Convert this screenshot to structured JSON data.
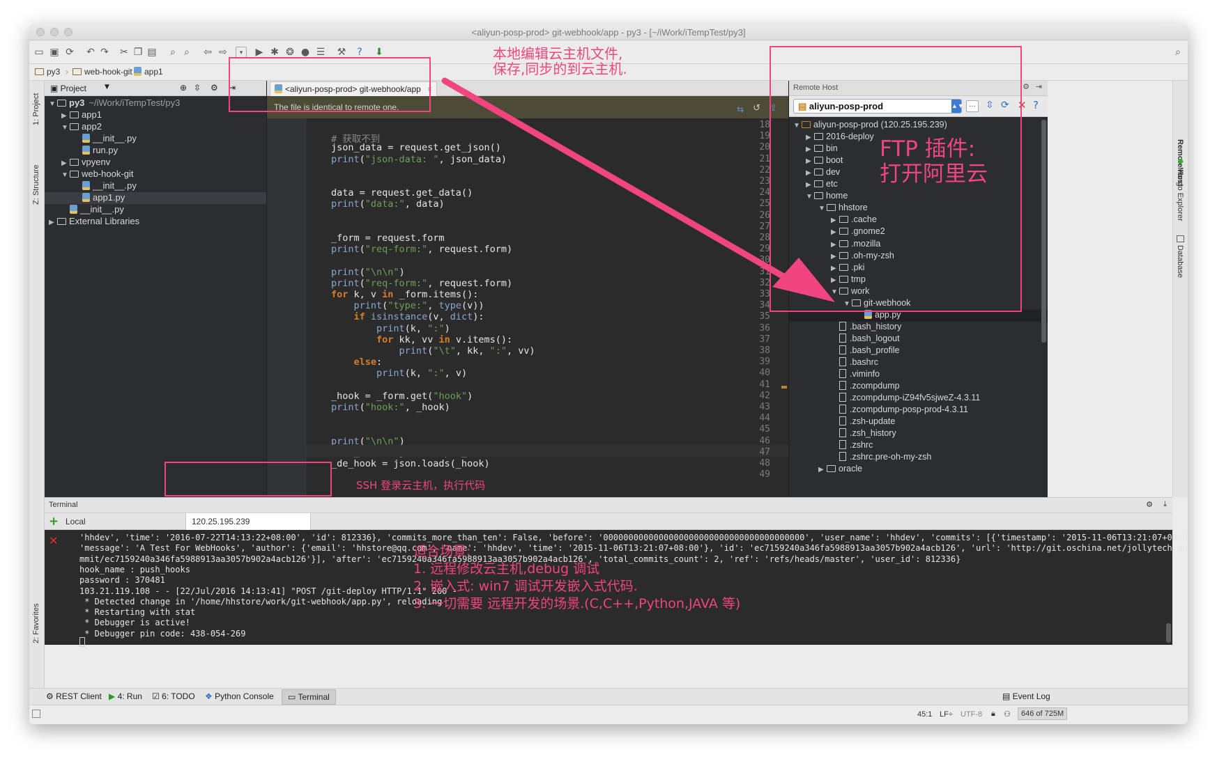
{
  "window": {
    "title": "<aliyun-posp-prod> git-webhook/app - py3 - [~/iWork/iTempTest/py3]"
  },
  "navbar": {
    "crumbs": [
      "py3",
      "web-hook-git",
      "app1"
    ]
  },
  "left_stripe": {
    "project_label": "1: Project",
    "structure_label": "Z: Structure",
    "favorites_label": "2: Favorites"
  },
  "project_panel": {
    "header": "Project",
    "tree": [
      {
        "label": "py3",
        "suffix": "~/iWork/iTempTest/py3",
        "type": "folder",
        "open": true
      },
      {
        "label": "app1",
        "type": "folder",
        "open": false
      },
      {
        "label": "app2",
        "type": "folder",
        "open": true
      },
      {
        "label": "__init__.py",
        "type": "py"
      },
      {
        "label": "run.py",
        "type": "py"
      },
      {
        "label": "vpyenv",
        "type": "folder",
        "open": false
      },
      {
        "label": "web-hook-git",
        "type": "folder",
        "open": true
      },
      {
        "label": "__init__.py",
        "type": "py"
      },
      {
        "label": "app1.py",
        "type": "py",
        "selected": true
      },
      {
        "label": "__init__.py",
        "type": "py"
      },
      {
        "label": "External Libraries",
        "type": "lib",
        "open": false
      }
    ]
  },
  "editor": {
    "tab_label": "<aliyun-posp-prod> git-webhook/app",
    "notice": "The file is identical to remote one.",
    "line_numbers": [
      "18",
      "19",
      "20",
      "21",
      "22",
      "23",
      "24",
      "25",
      "26",
      "27",
      "28",
      "29",
      "30",
      "31",
      "32",
      "33",
      "34",
      "35",
      "36",
      "37",
      "38",
      "39",
      "40",
      "41",
      "42",
      "43",
      "44",
      "45",
      "46",
      "47",
      "48",
      "49"
    ],
    "lines": [
      "",
      "# 获取不到",
      "json_data = request.get_json()",
      "print(\"json-data: \", json_data)",
      "",
      "",
      "data = request.get_data()",
      "print(\"data:\", data)",
      "",
      "",
      "_form = request.form",
      "print(\"req-form:\", request.form)",
      "",
      "print(\"\\n\\n\")",
      "print(\"req-form:\", request.form)",
      "for k, v in _form.items():",
      "    print(\"type:\", type(v))",
      "    if isinstance(v, dict):",
      "        print(k, \":\")",
      "        for kk, vv in v.items():",
      "            print(\"\\t\", kk, \":\", vv)",
      "    else:",
      "        print(k, \":\", v)",
      "",
      "_hook = _form.get(\"hook\")",
      "print(\"hook:\", _hook)",
      "",
      "",
      "print(\"\\n\\n\")",
      "# de_hook = json.dumps(_hook)",
      "_de_hook = json.loads(_hook)",
      ""
    ]
  },
  "remote_host": {
    "header": "Remote Host",
    "server": "aliyun-posp-prod",
    "tree": [
      {
        "label": "aliyun-posp-prod (120.25.195.239)",
        "level": 0,
        "type": "server",
        "open": true
      },
      {
        "label": "2016-deploy",
        "level": 1,
        "type": "folder"
      },
      {
        "label": "bin",
        "level": 1,
        "type": "folder"
      },
      {
        "label": "boot",
        "level": 1,
        "type": "folder"
      },
      {
        "label": "dev",
        "level": 1,
        "type": "folder"
      },
      {
        "label": "etc",
        "level": 1,
        "type": "folder"
      },
      {
        "label": "home",
        "level": 1,
        "type": "folder",
        "open": true
      },
      {
        "label": "hhstore",
        "level": 2,
        "type": "folder",
        "open": true
      },
      {
        "label": ".cache",
        "level": 3,
        "type": "folder"
      },
      {
        "label": ".gnome2",
        "level": 3,
        "type": "folder"
      },
      {
        "label": ".mozilla",
        "level": 3,
        "type": "folder"
      },
      {
        "label": ".oh-my-zsh",
        "level": 3,
        "type": "folder"
      },
      {
        "label": ".pki",
        "level": 3,
        "type": "folder"
      },
      {
        "label": "tmp",
        "level": 3,
        "type": "folder"
      },
      {
        "label": "work",
        "level": 3,
        "type": "folder",
        "open": true
      },
      {
        "label": "git-webhook",
        "level": 4,
        "type": "folder",
        "open": true
      },
      {
        "label": "app.py",
        "level": 5,
        "type": "py",
        "selected": true
      },
      {
        "label": ".bash_history",
        "level": 3,
        "type": "file"
      },
      {
        "label": ".bash_logout",
        "level": 3,
        "type": "file"
      },
      {
        "label": ".bash_profile",
        "level": 3,
        "type": "file"
      },
      {
        "label": ".bashrc",
        "level": 3,
        "type": "file"
      },
      {
        "label": ".viminfo",
        "level": 3,
        "type": "file"
      },
      {
        "label": ".zcompdump",
        "level": 3,
        "type": "file"
      },
      {
        "label": ".zcompdump-iZ94fv5sjweZ-4.3.11",
        "level": 3,
        "type": "file"
      },
      {
        "label": ".zcompdump-posp-prod-4.3.11",
        "level": 3,
        "type": "file"
      },
      {
        "label": ".zsh-update",
        "level": 3,
        "type": "file"
      },
      {
        "label": ".zsh_history",
        "level": 3,
        "type": "file"
      },
      {
        "label": ".zshrc",
        "level": 3,
        "type": "file"
      },
      {
        "label": ".zshrc.pre-oh-my-zsh",
        "level": 3,
        "type": "file"
      },
      {
        "label": "oracle",
        "level": 2,
        "type": "folder"
      }
    ]
  },
  "right_stripe": {
    "remote_host": "Remote Host",
    "mongo": "Mongo Explorer",
    "database": "Database"
  },
  "terminal": {
    "header": "Terminal",
    "tabs": [
      "Local",
      "120.25.195.239"
    ],
    "lines": [
      "'hhdev', 'time': '2016-07-22T14:13:22+08:00', 'id': 812336}, 'commits_more_than_ten': False, 'before': '0000000000000000000000000000000000000000', 'user_name': 'hhdev', 'commits': [{'timestamp': '2015-11-06T13:21:07+08:00',",
      "'message': 'A Test For WebHooks', 'author': {'email': 'hhstore@qq.com', 'name': 'hhdev', 'time': '2015-11-06T13:21:07+08:00'}, 'id': 'ec7159240a346fa5988913aa3057b902a4acb126', 'url': 'http://git.oschina.net/jollytech/epay/co",
      "mmit/ec7159240a346fa5988913aa3057b902a4acb126'}], 'after': 'ec7159240a346fa5988913aa3057b902a4acb126', 'total_commits_count': 2, 'ref': 'refs/heads/master', 'user_id': 812336}",
      "hook_name : push_hooks",
      "password : 370481",
      "103.21.119.108 - - [22/Jul/2016 14:13:41] \"POST /git-deploy HTTP/1.1\" 200 -",
      " * Detected change in '/home/hhstore/work/git-webhook/app.py', reloading",
      " * Restarting with stat",
      " * Debugger is active!",
      " * Debugger pin code: 438-054-269"
    ]
  },
  "bottom_tools": [
    {
      "label": "REST Client"
    },
    {
      "label": "4: Run"
    },
    {
      "label": "6: TODO"
    },
    {
      "label": "Python Console"
    },
    {
      "label": "Terminal"
    }
  ],
  "event_log": "Event Log",
  "status": {
    "position": "45:1",
    "line_sep": "LF÷",
    "encoding": "UTF-8",
    "memory": "646 of 725M"
  },
  "annotations": {
    "top": [
      "本地编辑云主机文件,",
      "保存,同步的到云主机."
    ],
    "ftp": [
      "FTP 插件:",
      "打开阿里云"
    ],
    "ssh": "SSH 登录云主机，执行代码",
    "scenes": [
      "适合场景:",
      "1. 远程修改云主机,debug 调试",
      "2. 嵌入式: win7 调试开发嵌入式代码.",
      "3. 一切需要 远程开发的场景.(C,C++,Python,JAVA 等)"
    ]
  },
  "colors": {
    "annotation": "#f0457f",
    "editor_bg": "#2b2b2b",
    "keyword": "#d67e27",
    "string": "#6f9f59"
  }
}
